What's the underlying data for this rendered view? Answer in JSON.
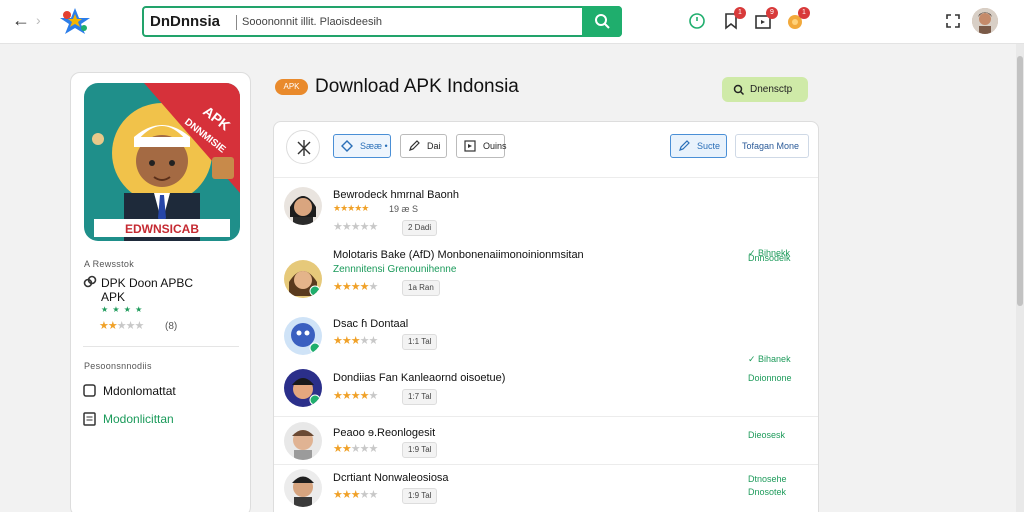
{
  "header": {
    "brand": "DnDnnsia",
    "search_value": "Sooononnit illit. Plaoisdeesih",
    "badges": [
      "1",
      "9",
      "1"
    ]
  },
  "left_card": {
    "banner_top": "APK",
    "banner_mid": "DNNMISIE",
    "banner_bottom": "EDWNSICAB",
    "section1_label": "A Rewsstok",
    "app_name_line1": "DPK Doon APBC",
    "app_name_line2": "APK",
    "rating_count": "(8)",
    "section2_label": "Pesoonsnnodiis",
    "link1": "Mdonlomattat",
    "link2": "Modonlicittan"
  },
  "title_area": {
    "pill": "APK",
    "title": "Download APK Indonsia",
    "action_button": "Dnensctp"
  },
  "toolbar": {
    "filter1": "Sææ •",
    "filter2": "Dai",
    "filter3": "Ouins",
    "share": "Sucte",
    "sort": "Tofagan Mone"
  },
  "rows": [
    {
      "title": "Bewrodeck hmrnal Baonh",
      "sub": "",
      "stars": 5,
      "star_meta": "19  æ S",
      "chip": "2 Dadi",
      "right": ""
    },
    {
      "title": "Molotaris Bake (AfD) Monbonenaiimonoinionmsitan",
      "sub": "Zennnitensi Grenounihenne",
      "stars": 4,
      "star_meta": "",
      "chip": "1a Ran",
      "right": "✓ Bihnekk"
    },
    {
      "title": "Dsac ɦ Dontaal",
      "sub": "",
      "stars": 3,
      "star_meta": "",
      "chip": "1:1 Tal",
      "right": ""
    },
    {
      "title": "Dondiias Fan Kanleaornd oisoetue)",
      "sub": "",
      "stars": 4,
      "star_meta": "",
      "chip": "1:7 Tal",
      "right": "✓ Bihanek"
    },
    {
      "title": "Peaoo ɘ.Reonlogesit",
      "sub": "",
      "stars": 2,
      "star_meta": "",
      "chip": "1:9 Tal",
      "right": "Dieosesk"
    },
    {
      "title": "Dcrtiant Nonwaleosiosa",
      "sub": "",
      "stars": 3,
      "star_meta": "",
      "chip": "1:9 Tal",
      "right": "Dtnosehe"
    }
  ],
  "row_extras": {
    "right2": "Dnnsodeik",
    "right4b": "Doionnone",
    "right6b": "Dnosotek"
  }
}
